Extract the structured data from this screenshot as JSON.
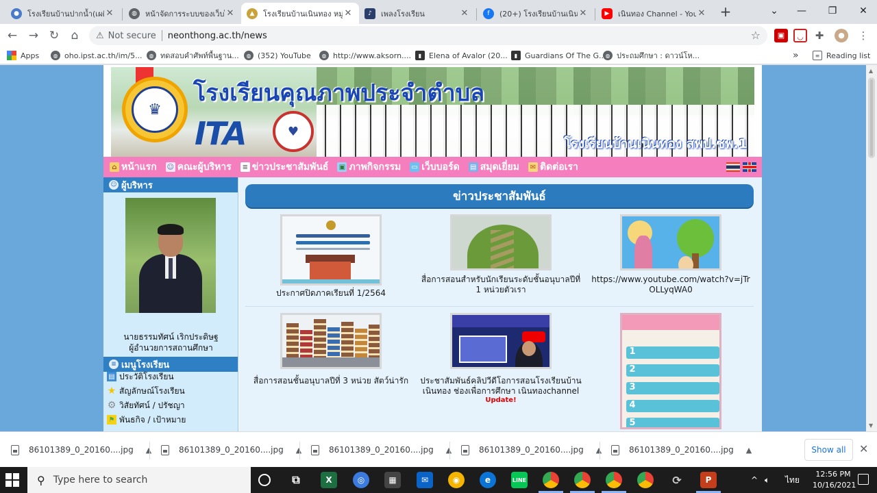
{
  "browser": {
    "tabs": [
      {
        "title": "โรงเรียนบ้านปากน้ำ(เผดิมศึ",
        "active": false
      },
      {
        "title": "หน้าจัดการระบบของเว็บไซต์",
        "active": false
      },
      {
        "title": "โรงเรียนบ้านเนินทอง หมู่ที่",
        "active": true
      },
      {
        "title": "เพลงโรงเรียน",
        "active": false
      },
      {
        "title": "(20+) โรงเรียนบ้านเนินทอง",
        "active": false
      },
      {
        "title": "เนินทอง Channel - YouTube",
        "active": false
      }
    ],
    "new_tab": "+",
    "security_label": "Not secure",
    "url": "neonthong.ac.th/news",
    "bookmarks": [
      "Apps",
      "oho.ipst.ac.th/im/5...",
      "ทดสอบคำศัพท์พื้นฐาน...",
      "(352) YouTube",
      "http://www.aksorn....",
      "Elena of Avalor (20...",
      "Guardians Of The G...",
      "ประถมศึกษา : ดาวน์โห..."
    ],
    "bookmarks_more": "»",
    "reading_list": "Reading list"
  },
  "site": {
    "banner_title": "โรงเรียนคุณภาพประจำตำบล",
    "ita_text": "ITA",
    "school_name": "โรงเรียนบ้านเนินทอง สพป.ชพ.1",
    "menu": [
      {
        "label": "หน้าแรก",
        "icon": "home-icon",
        "color": "#f0d36a"
      },
      {
        "label": "คณะผู้บริหาร",
        "icon": "people-icon",
        "color": "#fde6f3"
      },
      {
        "label": "ข่าวประชาสัมพันธ์",
        "icon": "news-icon",
        "color": "#ffffff"
      },
      {
        "label": "ภาพกิจกรรม",
        "icon": "image-icon",
        "color": "#9ad1f5"
      },
      {
        "label": "เว็บบอร์ด",
        "icon": "webboard-icon",
        "color": "#6cc1f0"
      },
      {
        "label": "สมุดเยี่ยม",
        "icon": "guestbook-icon",
        "color": "#7fb0e8"
      },
      {
        "label": "ติดต่อเรา",
        "icon": "mail-icon",
        "color": "#f5d77a"
      }
    ],
    "sidebar": {
      "executive_heading": "ผู้บริหาร",
      "executive_name": "นายธรรมทัศน์ เริกประดิษฐ",
      "executive_title": "ผู้อำนวยการสถานศึกษา",
      "menu_heading": "เมนูโรงเรียน",
      "links": [
        {
          "label": "ประวัติโรงเรียน",
          "icon": "book-icon",
          "color": "#3d8ad6"
        },
        {
          "label": "สัญลักษณ์โรงเรียน",
          "icon": "star-icon",
          "color": "#f5c400"
        },
        {
          "label": "วิสัยทัศน์ / ปรัชญา",
          "icon": "gear-icon",
          "color": "#8a8a8a"
        },
        {
          "label": "พันธกิจ / เป้าหมาย",
          "icon": "flag-icon",
          "color": "#5da83a"
        }
      ]
    },
    "news_heading": "ข่าวประชาสัมพันธ์",
    "news": [
      {
        "caption": "ประกาศปิดภาคเรียนที่ 1/2564",
        "update": ""
      },
      {
        "caption": "สื่อการสอนสำหรับนักเรียนระดับชั้นอนุบาลปีที่ 1 หน่วยตัวเรา",
        "update": ""
      },
      {
        "caption": "https://www.youtube.com/watch?v=jTrOLLyqWA0",
        "update": ""
      },
      {
        "caption": "สื่อการสอนชั้นอนุบาลปีที่ 3 หน่วย สัตว์น่ารัก",
        "update": ""
      },
      {
        "caption": "ประชาสัมพันธ์คลิปวีดีโอการสอนโรงเรียนบ้านเนินทอง ช่องเพื่อการศึกษา เนินทองchannel",
        "update": "Update!"
      },
      {
        "caption": "",
        "update": ""
      }
    ]
  },
  "downloads": {
    "items": [
      "86101389_0_20160....jpg",
      "86101389_0_20160....jpg",
      "86101389_0_20160....jpg",
      "86101389_0_20160....jpg",
      "86101389_0_20160....jpg"
    ],
    "show_all": "Show all"
  },
  "taskbar": {
    "search_placeholder": "Type here to search",
    "language": "ไทย",
    "time": "12:56 PM",
    "date": "10/16/2021"
  }
}
